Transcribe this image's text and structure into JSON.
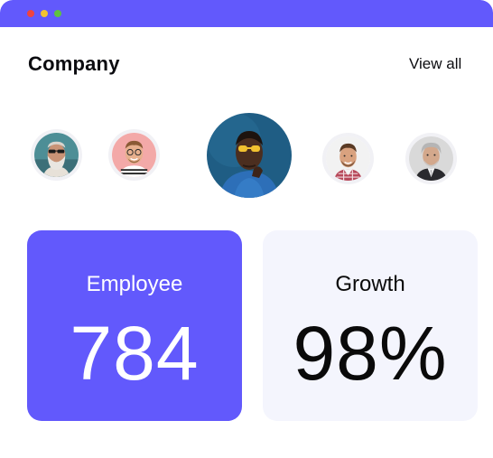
{
  "window": {
    "accent_color": "#6259fc",
    "controls": [
      "close-dot",
      "minimize-dot",
      "maximize-dot"
    ]
  },
  "header": {
    "title": "Company",
    "view_all": "View all"
  },
  "avatars": [
    {
      "name": "avatar-older-man-sunglasses"
    },
    {
      "name": "avatar-man-glasses-striped-shirt"
    },
    {
      "name": "avatar-featured-man-blue"
    },
    {
      "name": "avatar-man-plaid-shirt"
    },
    {
      "name": "avatar-older-man-suit"
    }
  ],
  "stats": {
    "employee": {
      "label": "Employee",
      "value": "784",
      "background": "#6259fc"
    },
    "growth": {
      "label": "Growth",
      "value": "98%",
      "background": "#f4f5fd"
    }
  }
}
